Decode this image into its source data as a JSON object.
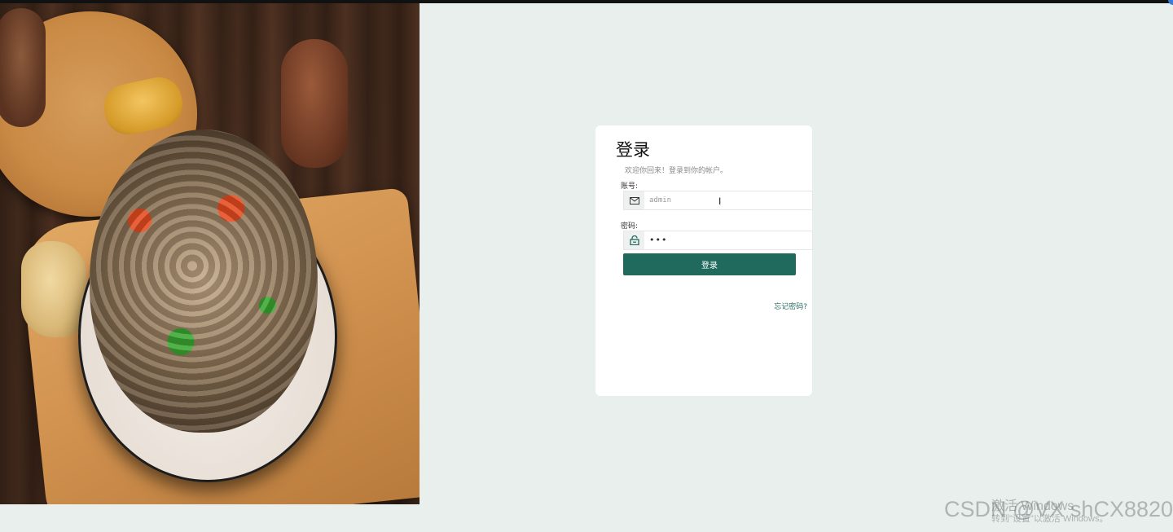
{
  "login": {
    "title": "登录",
    "subtitle": "欢迎你回来！登录到你的帐户。",
    "account_label": "账号:",
    "account_value": "admin",
    "password_label": "密码:",
    "password_value": "•••",
    "submit_label": "登录",
    "forgot_label": "忘记密码?"
  },
  "icons": {
    "account": "mail-icon",
    "password": "lock-icon",
    "cursor": "text-cursor-icon"
  },
  "colors": {
    "page_background": "#e9efed",
    "card_background": "#ffffff",
    "primary_button": "#206a5d",
    "link": "#2a6c62"
  },
  "watermarks": {
    "csdn": "CSDN @VX shCX8820",
    "activate_title": "激活 Windows",
    "activate_subtitle": "转到\"设置\"以激活 Windows。"
  }
}
